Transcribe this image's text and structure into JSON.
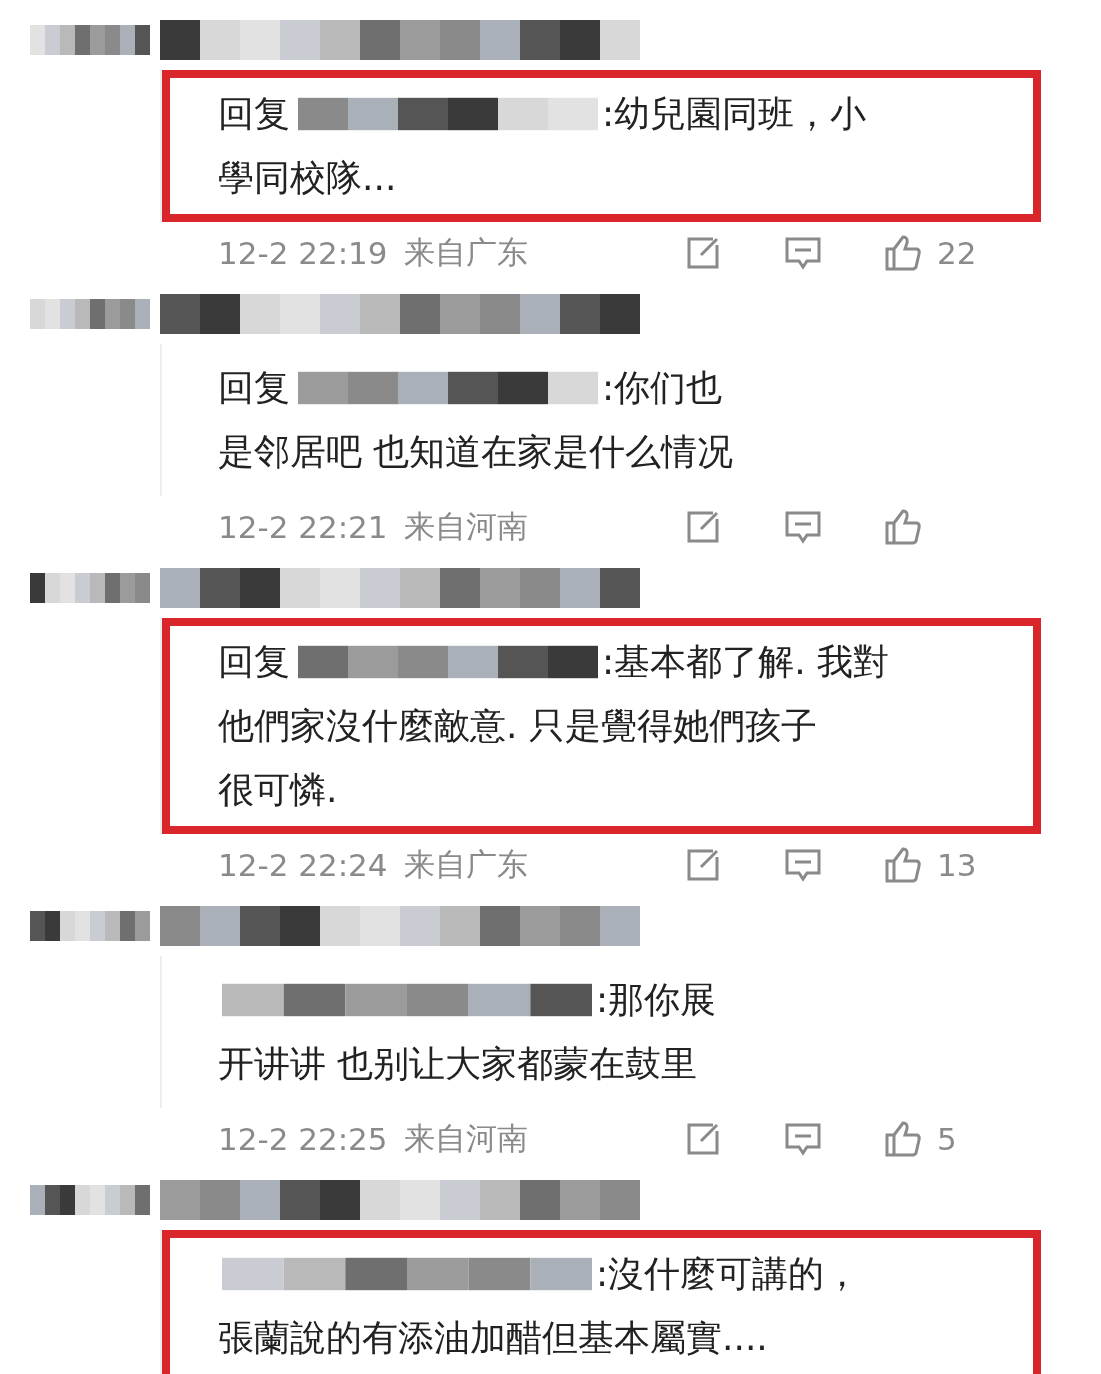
{
  "comments": [
    {
      "highlighted": true,
      "reply_prefix": "回复",
      "lines": [
        ":幼兒園同班，小",
        "學同校隊..."
      ],
      "time": "12-2 22:19",
      "location": "来自广东",
      "likes": "22"
    },
    {
      "highlighted": false,
      "reply_prefix": "回复",
      "lines": [
        ":你们也",
        "是邻居吧 也知道在家是什么情况"
      ],
      "time": "12-2 22:21",
      "location": "来自河南"
    },
    {
      "highlighted": true,
      "reply_prefix": "回复",
      "lines": [
        ":基本都了解. 我對",
        "他們家沒什麼敵意. 只是覺得她們孩子",
        "很可憐."
      ],
      "time": "12-2 22:24",
      "location": "来自广东",
      "likes": "13"
    },
    {
      "highlighted": false,
      "lines": [
        ":那你展",
        "开讲讲 也别让大家都蒙在鼓里"
      ],
      "time": "12-2 22:25",
      "location": "来自河南",
      "likes": "5"
    },
    {
      "highlighted": true,
      "lines": [
        ":沒什麼可講的，",
        "張蘭說的有添油加醋但基本屬實...."
      ]
    }
  ]
}
